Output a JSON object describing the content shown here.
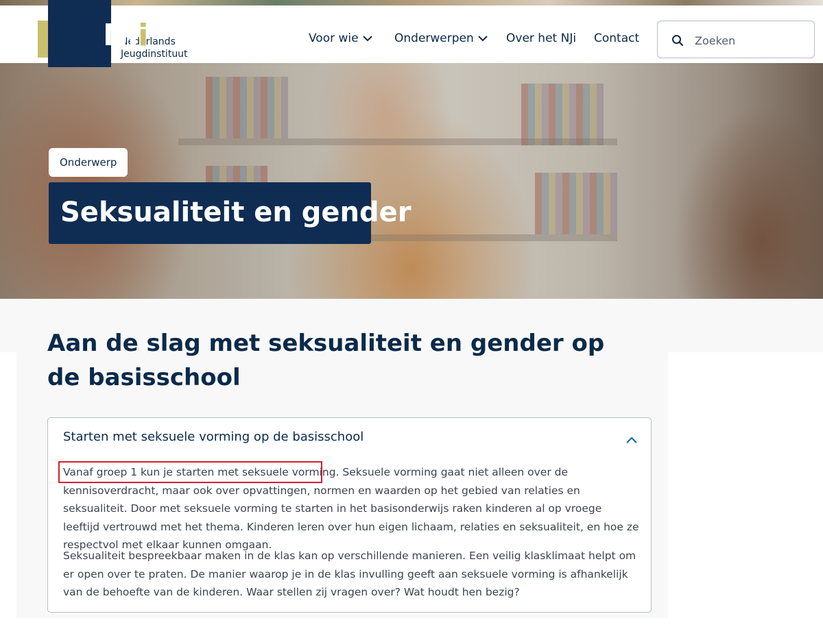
{
  "header": {
    "logo": {
      "main": "NJ",
      "accent": "i"
    },
    "org_name_line1": "Nederlands",
    "org_name_line2": "Jeugdinstituut",
    "nav": [
      {
        "label": "Voor wie",
        "dropdown": true
      },
      {
        "label": "Onderwerpen",
        "dropdown": true
      },
      {
        "label": "Over het NJi",
        "dropdown": false
      },
      {
        "label": "Contact",
        "dropdown": false
      }
    ],
    "search": {
      "placeholder": "Zoeken",
      "icon": "search-icon"
    }
  },
  "hero": {
    "badge": "Onderwerp",
    "title": "Seksualiteit en gender"
  },
  "main": {
    "section_title": "Aan de slag met seksualiteit en gender op de basisschool",
    "accordion": {
      "heading": "Starten met seksuele vorming op de basisschool",
      "expanded": true,
      "toggle_icon": "chevron-up-icon",
      "paragraph1_highlight": "Vanaf groep 1 kun je starten met seksuele vorming.",
      "paragraph1_rest": " Seksuele vorming gaat niet alleen over de kennisoverdracht, maar ook over opvattingen, normen en waarden op het gebied van relaties en seksualiteit. Door met seksuele vorming te starten in het basisonderwijs raken kinderen al op vroege leeftijd vertrouwd met het thema. Kinderen leren over hun eigen lichaam, relaties en seksualiteit, en hoe ze respectvol met elkaar kunnen omgaan.",
      "paragraph2": "Seksualiteit bespreekbaar maken in de klas kan op verschillende manieren. Een veilig klasklimaat helpt om er open over te praten. De manier waarop je in de klas invulling geeft aan seksuele vorming is afhankelijk van de behoefte van de kinderen. Waar stellen zij vragen over? Wat houdt hen bezig?"
    }
  },
  "colors": {
    "brand_navy": "#0f2d52",
    "brand_gold": "#cbbf6e",
    "highlight_box": "#d0202e"
  }
}
